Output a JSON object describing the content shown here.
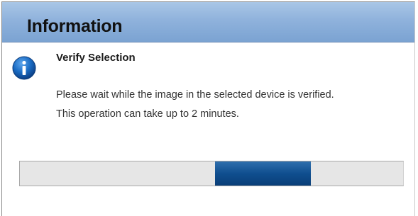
{
  "dialog": {
    "title": "Information",
    "icon": "info-icon",
    "heading": "Verify Selection",
    "message_lines": [
      "Please wait while the image in the selected device is verified.",
      "This operation can take up to 2 minutes."
    ],
    "progress": {
      "style": "indeterminate",
      "indicator_start_fraction": 0.51,
      "indicator_end_fraction": 0.76,
      "accent_color": "#0f4e8f"
    }
  },
  "colors": {
    "titlebar": "#8fb2dc",
    "info_icon": "#1565b5"
  }
}
